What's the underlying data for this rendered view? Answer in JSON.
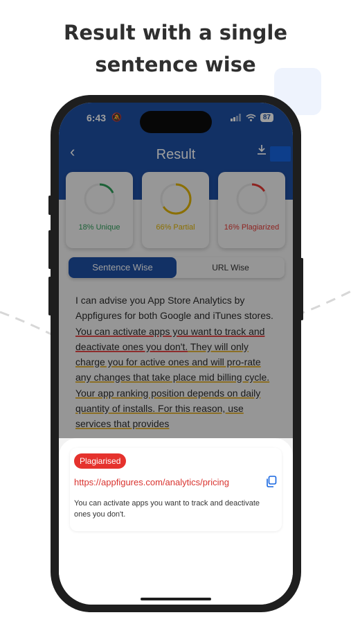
{
  "headline": {
    "line1": "Result with a single",
    "line2": "sentence wise"
  },
  "status_bar": {
    "time": "6:43",
    "battery": "87"
  },
  "nav": {
    "title": "Result"
  },
  "stats": [
    {
      "label": "18% Unique",
      "percent": 18,
      "color": "#2f9e5b"
    },
    {
      "label": "66% Partial",
      "percent": 66,
      "color": "#e0b400"
    },
    {
      "label": "16% Plagiarized",
      "percent": 16,
      "color": "#e53935"
    }
  ],
  "tabs": {
    "sentence": "Sentence Wise",
    "url": "URL Wise"
  },
  "content": {
    "plain": "I can advise you App Store Analytics by Appfigures for both Google and iTunes stores. ",
    "red_underlined": "You can activate apps you want to track and deactivate ones you don't.",
    "yellow_underlined": " They will only charge you for active ones and will pro-rate any changes that take place mid billing cycle. Your app ranking position depends on daily quantity of installs. For this reason, use services that provides"
  },
  "result": {
    "badge": "Plagiarised",
    "url": "https://appfigures.com/analytics/pricing",
    "snippet": "You can activate apps you want to track and deactivate ones you don't."
  },
  "colors": {
    "primary": "#1e4fa3",
    "plagiarised": "#e5322d"
  }
}
